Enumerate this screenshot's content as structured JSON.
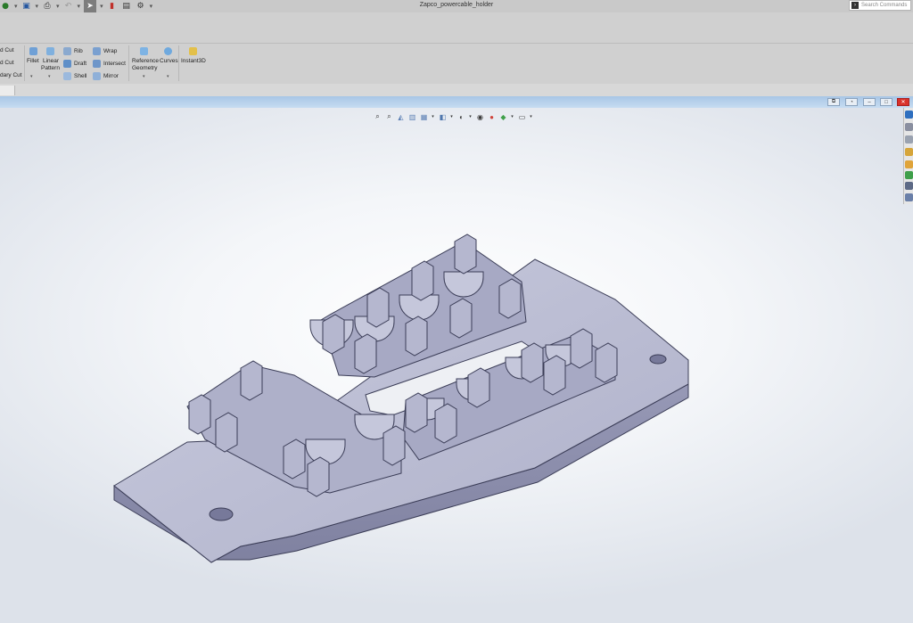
{
  "window": {
    "title": "Zapco_powercable_holder",
    "search_placeholder": "Search Commands"
  },
  "quick_access": [
    {
      "name": "options-icon",
      "glyph": "⚙"
    }
  ],
  "ribbon": {
    "partial_labels": [
      "d Cut",
      "d Cut",
      "dary Cut"
    ],
    "fillet": "Fillet",
    "linear_pattern_1": "Linear",
    "linear_pattern_2": "Pattern",
    "rib": "Rib",
    "draft": "Draft",
    "shell": "Shell",
    "wrap": "Wrap",
    "intersect": "Intersect",
    "mirror": "Mirror",
    "reference_geometry_1": "Reference",
    "reference_geometry_2": "Geometry",
    "curves": "Curves",
    "instant3d": "Instant3D"
  },
  "model": {
    "name": "Zapco_powercable_holder",
    "face_color": "#b9bbd2",
    "side_color": "#8e90b0",
    "edge_color": "#3b3d57"
  }
}
